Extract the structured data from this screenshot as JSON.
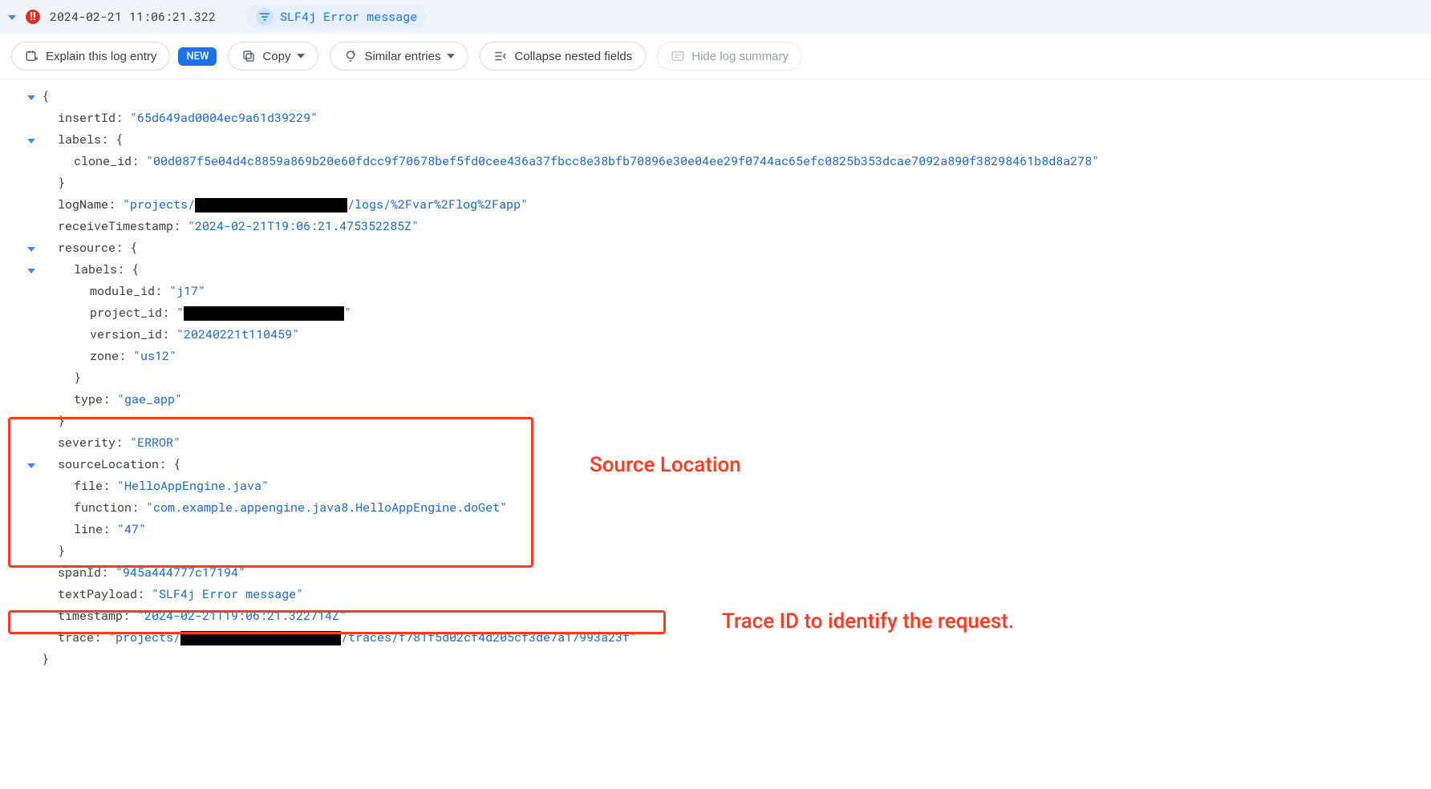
{
  "header": {
    "severity_glyph": "!!",
    "timestamp": "2024-02-21 11:06:21.322",
    "chip_label": "SLF4j Error message"
  },
  "toolbar": {
    "explain": "Explain this log entry",
    "new_pill": "NEW",
    "copy": "Copy",
    "similar": "Similar entries",
    "collapse": "Collapse nested fields",
    "hide_summary": "Hide log summary"
  },
  "json": {
    "insertId_key": "insertId:",
    "insertId_val": "\"65d649ad0004ec9a61d39229\"",
    "labels_key": "labels: {",
    "clone_id_key": "clone_id:",
    "clone_id_val": "\"00d087f5e04d4c8859a869b20e60fdcc9f70678bef5fd0cee436a37fbcc8e38bfb70896e30e04ee29f0744ac65efc0825b353dcae7092a890f38298461b8d8a278\"",
    "close_brace": "}",
    "logName_key": "logName:",
    "logName_pre": "\"projects/",
    "logName_post": "/logs/%2Fvar%2Flog%2Fapp\"",
    "receiveTimestamp_key": "receiveTimestamp:",
    "receiveTimestamp_val": "\"2024-02-21T19:06:21.475352285Z\"",
    "resource_key": "resource: {",
    "r_labels_key": "labels: {",
    "module_id_key": "module_id:",
    "module_id_val": "\"j17\"",
    "project_id_key": "project_id:",
    "project_id_pre": "\"",
    "project_id_post": "\"",
    "version_id_key": "version_id:",
    "version_id_val": "\"20240221t110459\"",
    "zone_key": "zone:",
    "zone_val": "\"us12\"",
    "type_key": "type:",
    "type_val": "\"gae_app\"",
    "severity_key": "severity:",
    "severity_val": "\"ERROR\"",
    "sourceLocation_key": "sourceLocation: {",
    "file_key": "file:",
    "file_val": "\"HelloAppEngine.java\"",
    "function_key": "function:",
    "function_val": "\"com.example.appengine.java8.HelloAppEngine.doGet\"",
    "line_key": "line:",
    "line_val": "\"47\"",
    "spanId_key": "spanId:",
    "spanId_val": "\"945a444777c17194\"",
    "textPayload_key": "textPayload:",
    "textPayload_val": "\"SLF4j Error message\"",
    "timestamp_key": "timestamp:",
    "timestamp_val": "\"2024-02-21T19:06:21.322714Z\"",
    "trace_key": "trace:",
    "trace_pre": "\"projects/",
    "trace_post": "/traces/f781f5d02cf4d205cf3de7a17993a23f\"",
    "open_brace": "{"
  },
  "annotations": {
    "source_location": "Source Location",
    "trace_id": "Trace ID to identify the request."
  }
}
